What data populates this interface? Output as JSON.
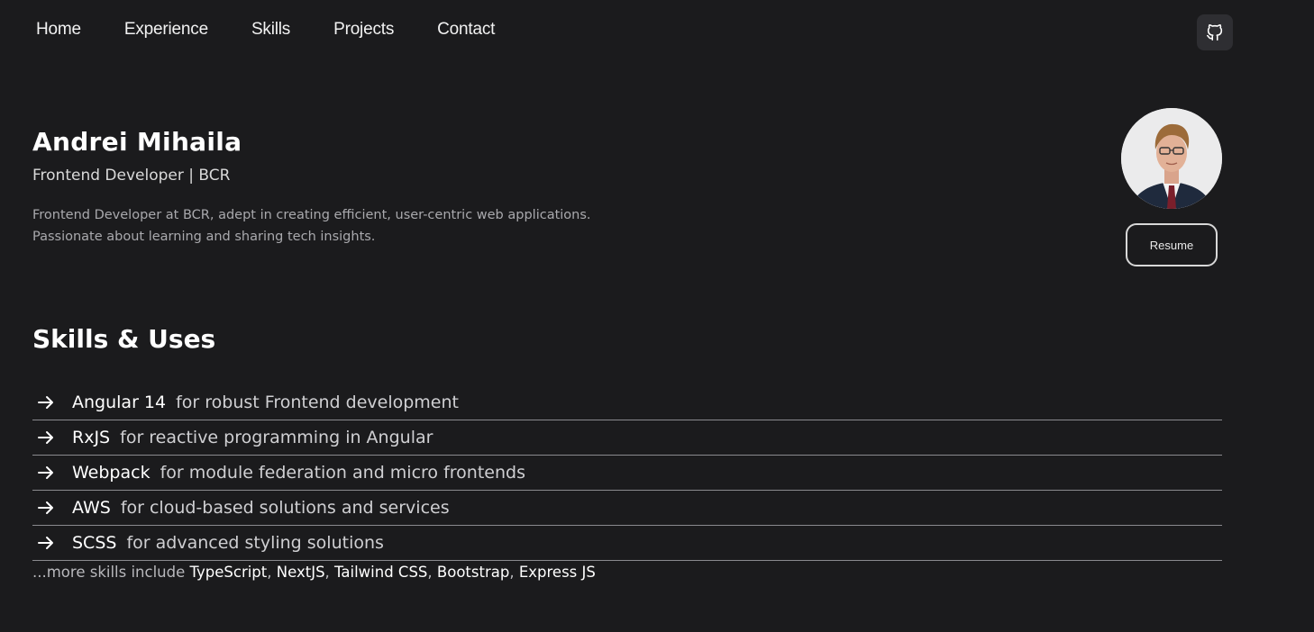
{
  "nav": {
    "items": [
      "Home",
      "Experience",
      "Skills",
      "Projects",
      "Contact"
    ]
  },
  "icons": {
    "github": "github-icon",
    "arrow": "arrow-right-icon"
  },
  "hero": {
    "name": "Andrei Mihaila",
    "role": "Frontend Developer | BCR",
    "bio_line1": "Frontend Developer at BCR, adept in creating efficient, user-centric web applications.",
    "bio_line2": "Passionate about learning and sharing tech insights.",
    "resume_label": "Resume"
  },
  "skills": {
    "title": "Skills & Uses",
    "items": [
      {
        "name": "Angular 14",
        "desc": "for robust Frontend development"
      },
      {
        "name": "RxJS",
        "desc": "for reactive programming in Angular"
      },
      {
        "name": "Webpack",
        "desc": "for module federation and micro frontends"
      },
      {
        "name": "AWS",
        "desc": "for cloud-based solutions and services"
      },
      {
        "name": "SCSS",
        "desc": "for advanced styling solutions"
      }
    ],
    "more_prefix": "...more skills include",
    "more": [
      "TypeScript",
      "NextJS",
      "Tailwind CSS",
      "Bootstrap",
      "Express JS"
    ],
    "separator": ","
  },
  "colors": {
    "background": "#1b1b1d",
    "text": "#ffffff",
    "muted": "#a9a9ad",
    "divider": "#8a8a8e"
  }
}
